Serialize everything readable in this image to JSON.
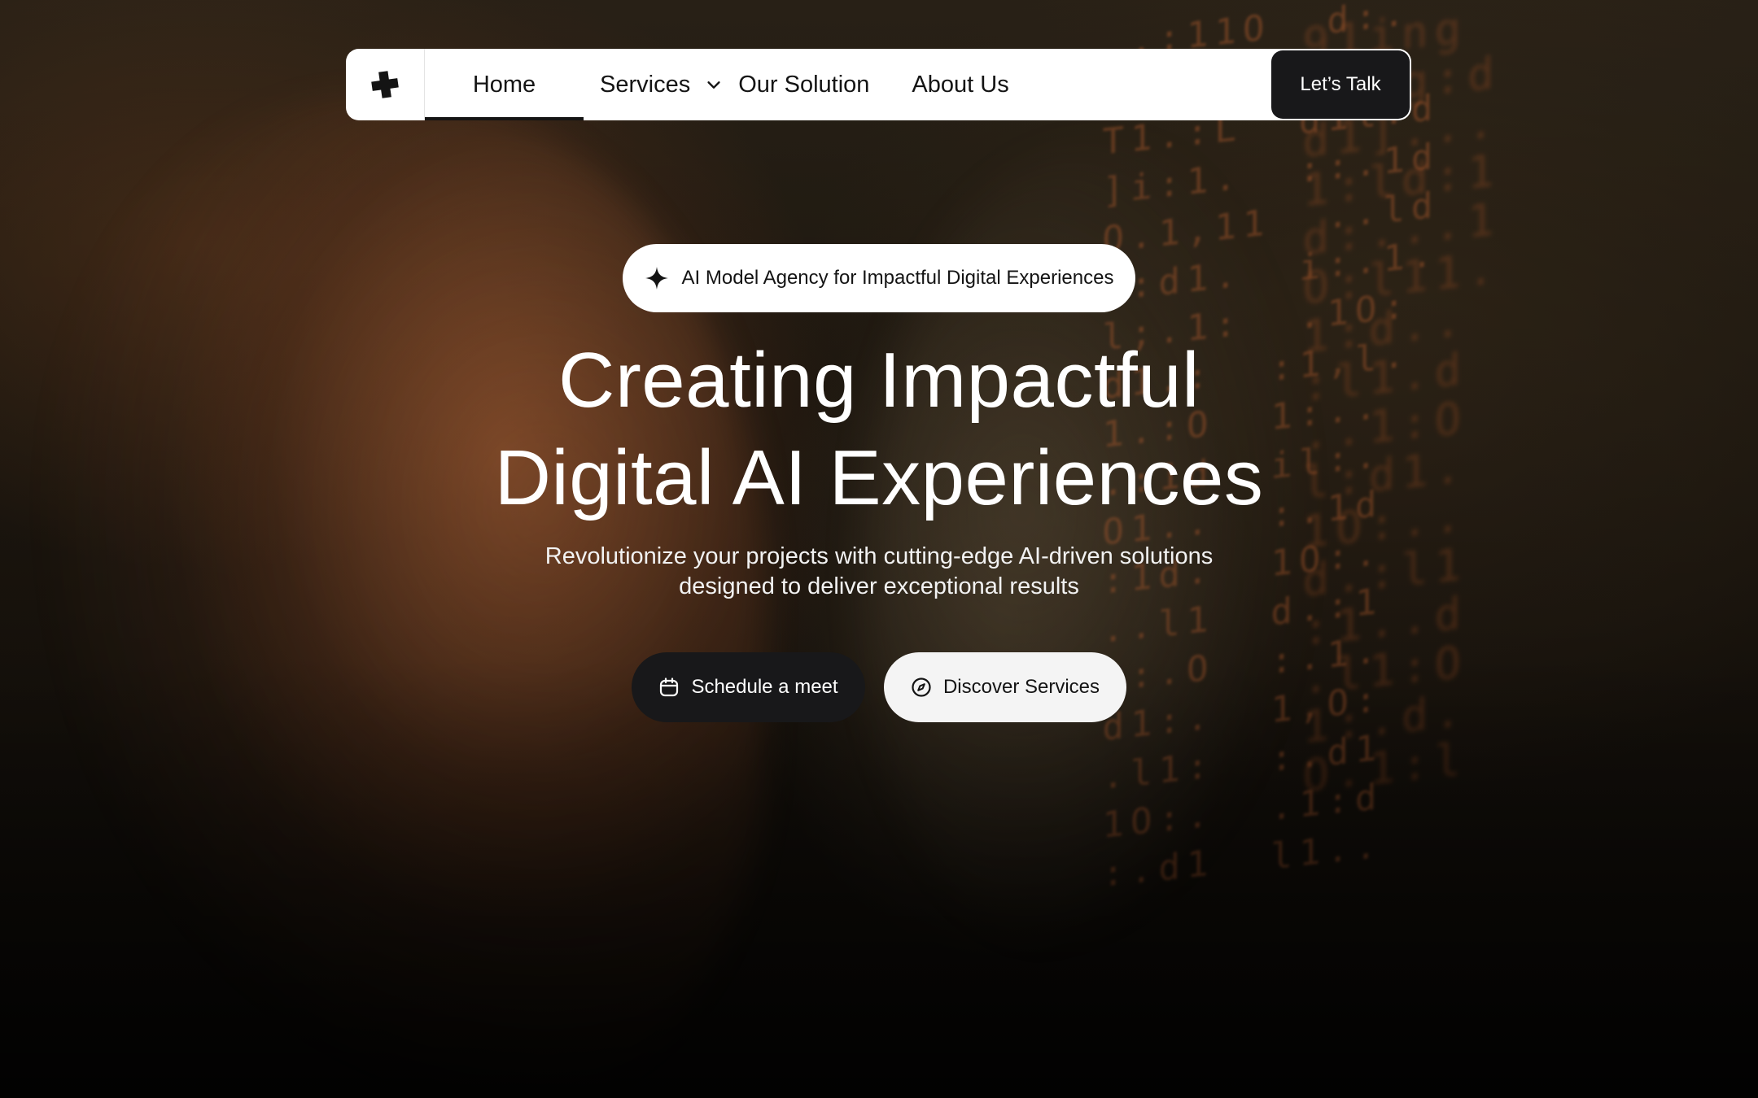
{
  "nav": {
    "logo_icon": "plus-logo-icon",
    "items": [
      {
        "label": "Home",
        "active": true
      },
      {
        "label": "Services",
        "icon": "chevron-down-icon"
      },
      {
        "label": "Our Solution"
      },
      {
        "label": "About Us"
      }
    ],
    "cta_label": "Let’s Talk"
  },
  "hero": {
    "badge": {
      "icon": "sparkle-icon",
      "text": "AI Model Agency for Impactful Digital Experiences"
    },
    "headline": {
      "line1": "Creating Impactful",
      "line2": "Digital AI Experiences"
    },
    "subtext": {
      "line1": "Revolutionize your projects with cutting-edge AI-driven solutions",
      "line2": "designed to deliver exceptional results"
    },
    "buttons": {
      "primary": {
        "label": "Schedule a meet",
        "icon": "calendar-icon"
      },
      "secondary": {
        "label": "Discover Services",
        "icon": "compass-icon"
      }
    }
  },
  "colors": {
    "nav_bg": "#ffffff",
    "dark_button": "#18181a",
    "light_button": "#f4f4f4",
    "text_light": "#ffffff",
    "code_accent": "#d66c34"
  }
}
